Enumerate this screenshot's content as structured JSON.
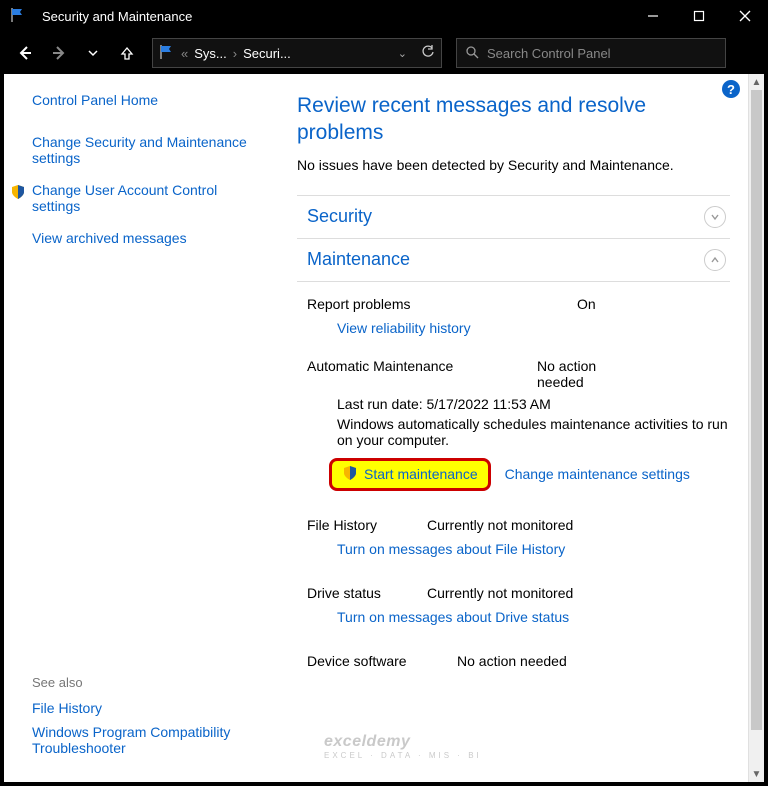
{
  "window": {
    "title": "Security and Maintenance"
  },
  "nav": {
    "crumb1": "Sys...",
    "crumb2": "Securi...",
    "search_placeholder": "Search Control Panel"
  },
  "sidebar": {
    "home": "Control Panel Home",
    "link1": "Change Security and Maintenance settings",
    "link2": "Change User Account Control settings",
    "link3": "View archived messages",
    "see_also_hdr": "See also",
    "see1": "File History",
    "see2": "Windows Program Compatibility Troubleshooter"
  },
  "main": {
    "heading": "Review recent messages and resolve problems",
    "subtext": "No issues have been detected by Security and Maintenance.",
    "security_title": "Security",
    "maint_title": "Maintenance",
    "report_label": "Report problems",
    "report_value": "On",
    "reliability_link": "View reliability history",
    "auto_maint_label": "Automatic Maintenance",
    "auto_maint_value": "No action needed",
    "last_run": "Last run date: 5/17/2022 11:53 AM",
    "auto_desc": "Windows automatically schedules maintenance activities to run on your computer.",
    "start_maint": "Start maintenance",
    "change_maint": "Change maintenance settings",
    "fh_label": "File History",
    "fh_value": "Currently not monitored",
    "fh_link": "Turn on messages about File History",
    "drive_label": "Drive status",
    "drive_value": "Currently not monitored",
    "drive_link": "Turn on messages about Drive status",
    "device_label": "Device software",
    "device_value": "No action needed"
  },
  "watermark": {
    "main": "exceldemy",
    "sub": "EXCEL · DATA · MIS · BI"
  }
}
